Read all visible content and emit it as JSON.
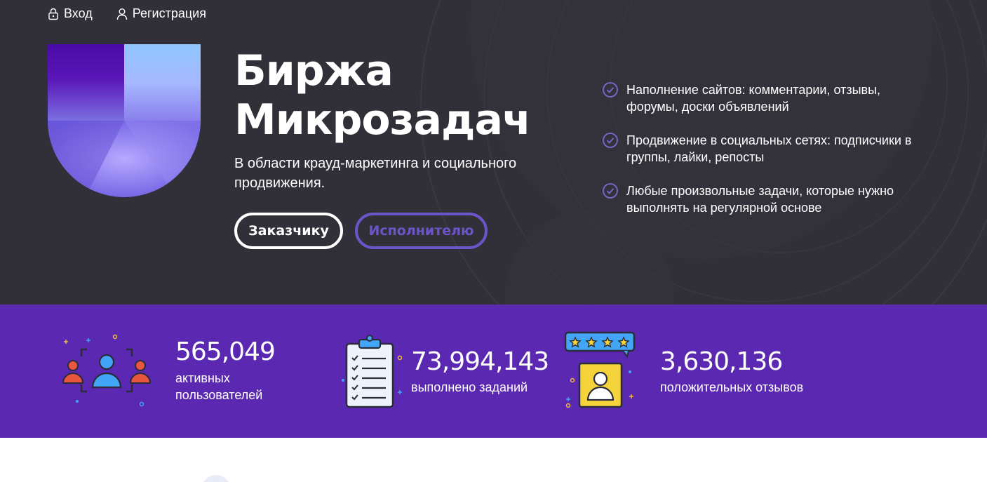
{
  "nav": {
    "login": "Вход",
    "register": "Регистрация"
  },
  "hero": {
    "title_line1": "Биржа",
    "title_line2": "Микрозадач",
    "subtitle": "В области крауд-маркетинга и социального продвижения.",
    "btn_customer": "Заказчику",
    "btn_executor": "Исполнителю"
  },
  "features": [
    {
      "text": "Наполнение сайтов: комментарии, отзывы, форумы, доски объявлений"
    },
    {
      "text": "Продвижение в социальных сетях: подписчики в группы, лайки, репосты"
    },
    {
      "text": "Любые произвольные задачи, которые нужно выполнять на регулярной основе"
    }
  ],
  "stats": [
    {
      "value": "565,049",
      "label_line1": "активных",
      "label_line2": "пользователей",
      "icon": "users-icon"
    },
    {
      "value": "73,994,143",
      "label_line1": "выполнено заданий",
      "icon": "clipboard-checklist-icon"
    },
    {
      "value": "3,630,136",
      "label_line1": "положительных отзывов",
      "icon": "review-stars-icon"
    }
  ],
  "colors": {
    "hero_bg": "#313038",
    "stats_bg": "#5b28b2",
    "accent": "#6b55c9"
  }
}
